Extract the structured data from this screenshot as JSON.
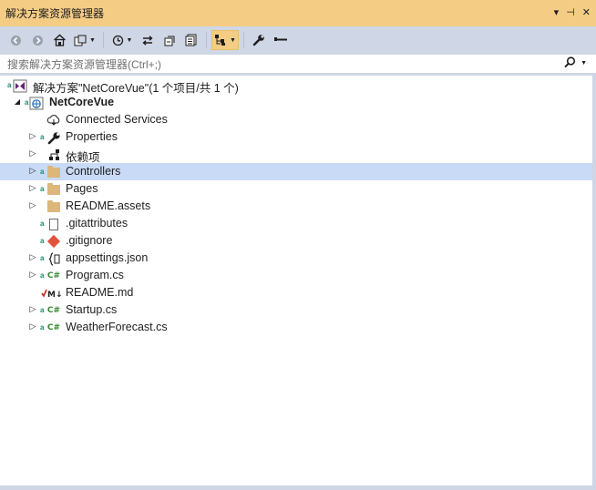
{
  "window": {
    "title": "解决方案资源管理器",
    "controls": {
      "dropdown": "▾",
      "pin": "⊣",
      "close": "✕"
    }
  },
  "toolbar": {
    "buttons": [
      {
        "name": "back-icon",
        "glyph": "◀"
      },
      {
        "name": "forward-icon",
        "glyph": "▶"
      },
      {
        "name": "home-icon",
        "glyph": "⌂"
      },
      {
        "name": "switch-views-icon",
        "glyph": "⧉"
      },
      {
        "name": "pending-changes-icon",
        "glyph": "⏱"
      },
      {
        "name": "sync-icon",
        "glyph": "⇆"
      },
      {
        "name": "collapse-all-icon",
        "glyph": "❐"
      },
      {
        "name": "show-all-files-icon",
        "glyph": "⧈"
      },
      {
        "name": "preview-selected-icon",
        "glyph": "⊞"
      },
      {
        "name": "properties-icon",
        "glyph": "🔧"
      },
      {
        "name": "minus-icon",
        "glyph": "▬"
      }
    ]
  },
  "search": {
    "placeholder": "搜索解决方案资源管理器(Ctrl+;)",
    "icon": "search-icon"
  },
  "tree": {
    "solution": "解决方案\"NetCoreVue\"(1 个项目/共 1 个)",
    "project": "NetCoreVue",
    "items": [
      {
        "label": "Connected Services",
        "icon": "connected-services-icon"
      },
      {
        "label": "Properties",
        "icon": "wrench-icon"
      },
      {
        "label": "依赖项",
        "icon": "dependencies-icon"
      },
      {
        "label": "Controllers",
        "icon": "folder-icon",
        "selected": true
      },
      {
        "label": "Pages",
        "icon": "folder-icon"
      },
      {
        "label": "README.assets",
        "icon": "folder-icon"
      },
      {
        "label": ".gitattributes",
        "icon": "file-icon"
      },
      {
        "label": ".gitignore",
        "icon": "git-icon"
      },
      {
        "label": "appsettings.json",
        "icon": "json-icon"
      },
      {
        "label": "Program.cs",
        "icon": "csharp-icon"
      },
      {
        "label": "README.md",
        "icon": "markdown-icon"
      },
      {
        "label": "Startup.cs",
        "icon": "csharp-icon"
      },
      {
        "label": "WeatherForecast.cs",
        "icon": "csharp-icon"
      }
    ]
  },
  "colors": {
    "titlebar": "#f5cc84",
    "chrome": "#cfd6e5",
    "selection": "#c9daf6",
    "folder": "#dcb67a",
    "csharp": "#368832",
    "git": "#e0523c"
  }
}
